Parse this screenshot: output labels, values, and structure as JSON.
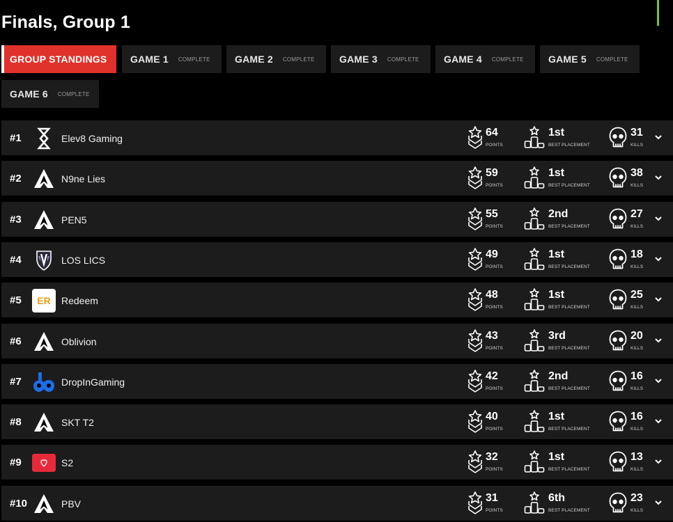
{
  "page": {
    "title": "Finals, Group 1"
  },
  "colors": {
    "accent": "#e0322b",
    "background": "#000000",
    "row": "#1c1c1c",
    "indicator": "#7cc043"
  },
  "tabs": [
    {
      "label": "GROUP STANDINGS",
      "status": "",
      "active": true
    },
    {
      "label": "GAME 1",
      "status": "COMPLETE"
    },
    {
      "label": "GAME 2",
      "status": "COMPLETE"
    },
    {
      "label": "GAME 3",
      "status": "COMPLETE"
    },
    {
      "label": "GAME 4",
      "status": "COMPLETE"
    },
    {
      "label": "GAME 5",
      "status": "COMPLETE"
    },
    {
      "label": "GAME 6",
      "status": "COMPLETE"
    }
  ],
  "labels": {
    "points": "POINTS",
    "best_placement": "BEST PLACEMENT",
    "kills": "KILLS"
  },
  "standings": [
    {
      "rank": "#1",
      "team": "Elev8 Gaming",
      "logo": "elev8-logo",
      "points": "64",
      "best": "1st",
      "kills": "31"
    },
    {
      "rank": "#2",
      "team": "N9ne Lies",
      "logo": "apex-logo",
      "points": "59",
      "best": "1st",
      "kills": "38"
    },
    {
      "rank": "#3",
      "team": "PEN5",
      "logo": "apex-logo",
      "points": "55",
      "best": "2nd",
      "kills": "27"
    },
    {
      "rank": "#4",
      "team": "LOS LICS",
      "logo": "shield-logo",
      "points": "49",
      "best": "1st",
      "kills": "18"
    },
    {
      "rank": "#5",
      "team": "Redeem",
      "logo": "redeem-logo",
      "points": "48",
      "best": "1st",
      "kills": "25"
    },
    {
      "rank": "#6",
      "team": "Oblivion",
      "logo": "apex-logo",
      "points": "43",
      "best": "3rd",
      "kills": "20"
    },
    {
      "rank": "#7",
      "team": "DropInGaming",
      "logo": "gamepad-logo",
      "points": "42",
      "best": "2nd",
      "kills": "16"
    },
    {
      "rank": "#8",
      "team": "SKT T2",
      "logo": "apex-logo",
      "points": "40",
      "best": "1st",
      "kills": "16"
    },
    {
      "rank": "#9",
      "team": "S2",
      "logo": "s2-logo",
      "points": "32",
      "best": "1st",
      "kills": "13"
    },
    {
      "rank": "#10",
      "team": "PBV",
      "logo": "apex-logo",
      "points": "31",
      "best": "6th",
      "kills": "23"
    }
  ]
}
